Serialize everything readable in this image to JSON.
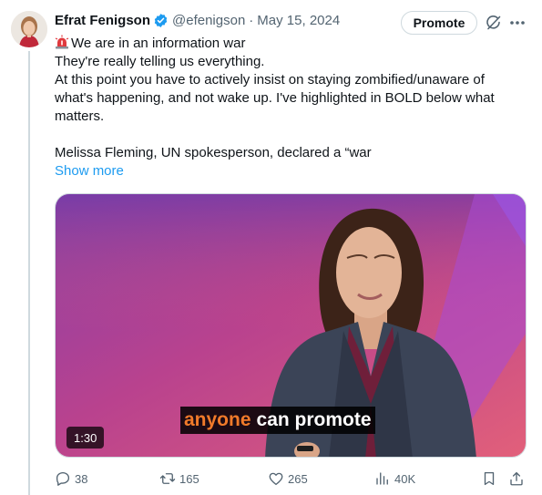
{
  "tweet": {
    "author_name": "Efrat Fenigson",
    "handle": "@efenigson",
    "separator": "·",
    "date": "May 15, 2024",
    "promote_label": "Promote",
    "lines": [
      "We are in an information war",
      "They're really telling us everything.",
      "At this point you have to actively insist on staying zombified/unaware of",
      "what's happening, and not wake up. I've highlighted in BOLD below what",
      "matters.",
      "Melissa Fleming, UN spokesperson, declared a “war"
    ],
    "show_more": "Show more"
  },
  "video": {
    "caption_highlight": "anyone",
    "caption_rest": "can promote",
    "duration": "1:30"
  },
  "actions": {
    "replies": "38",
    "reposts": "165",
    "likes": "265",
    "views": "40K"
  },
  "colors": {
    "accent": "#1d9bf0",
    "text_secondary": "#536471",
    "caption_highlight": "#f07a2a"
  },
  "icons": [
    "verified-badge-icon",
    "grok-icon",
    "more-icon",
    "siren-emoji-icon",
    "reply-icon",
    "repost-icon",
    "like-icon",
    "views-icon",
    "bookmark-icon",
    "share-icon"
  ]
}
